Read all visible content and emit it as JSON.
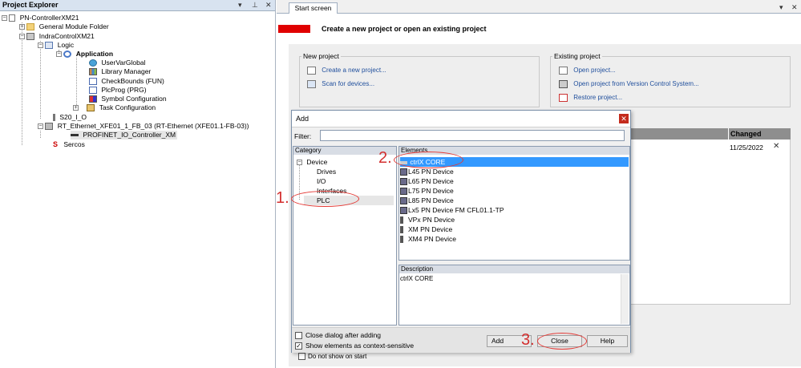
{
  "project_explorer": {
    "title": "Project Explorer",
    "pin_icon": "pin-icon",
    "close_icon": "close-icon",
    "tree": [
      {
        "label": "PN-ControllerXM21",
        "indent": 0,
        "expander": "-",
        "icon": "project-icon"
      },
      {
        "label": "General Module Folder",
        "indent": 1,
        "expander": "+",
        "icon": "folder-icon"
      },
      {
        "label": "IndraControlXM21",
        "indent": 1,
        "expander": "-",
        "icon": "device-icon"
      },
      {
        "label": "Logic",
        "indent": 2,
        "expander": "-",
        "icon": "logic-icon"
      },
      {
        "label": "Application",
        "indent": 3,
        "expander": "-",
        "icon": "application-icon",
        "bold": true
      },
      {
        "label": "UserVarGlobal",
        "indent": 4,
        "icon": "globe-icon"
      },
      {
        "label": "Library Manager",
        "indent": 4,
        "icon": "library-icon"
      },
      {
        "label": "CheckBounds (FUN)",
        "indent": 4,
        "icon": "function-icon"
      },
      {
        "label": "PlcProg (PRG)",
        "indent": 4,
        "icon": "program-icon"
      },
      {
        "label": "Symbol Configuration",
        "indent": 4,
        "icon": "symbol-icon"
      },
      {
        "label": "Task Configuration",
        "indent": 4,
        "expander": "+",
        "icon": "task-icon"
      },
      {
        "label": "S20_I_O",
        "indent": 2,
        "icon": "io-icon"
      },
      {
        "label": "RT_Ethernet_XFE01_1_FB_03 (RT-Ethernet (XFE01.1-FB-03))",
        "indent": 1,
        "expander": "-",
        "icon": "ethernet-icon"
      },
      {
        "label": "PROFINET_IO_Controller_XM",
        "indent": 2,
        "icon": "profinet-icon",
        "selected": true
      },
      {
        "label": "Sercos",
        "indent": 1,
        "icon": "sercos-icon"
      }
    ]
  },
  "start_screen": {
    "tab_label": "Start screen",
    "heading": "Create a new project or open an existing project",
    "accent_color": "#e00000",
    "new_project": {
      "title": "New project",
      "links": [
        {
          "label": "Create a new project...",
          "icon": "new-project-icon"
        },
        {
          "label": "Scan for devices...",
          "icon": "scan-icon"
        }
      ]
    },
    "existing_project": {
      "title": "Existing project",
      "links": [
        {
          "label": "Open project...",
          "icon": "open-project-icon"
        },
        {
          "label": "Open project from Version Control System...",
          "icon": "vcs-icon"
        },
        {
          "label": "Restore project...",
          "icon": "restore-icon"
        }
      ]
    },
    "recent": {
      "changed_header": "Changed",
      "changed_value": "11/25/2022",
      "remove_icon": "remove-icon"
    },
    "do_not_show": "Do not show on start"
  },
  "add_dialog": {
    "title": "Add",
    "filter_label": "Filter:",
    "filter_value": "",
    "category_header": "Category",
    "categories": [
      {
        "label": "Device",
        "expander": "-"
      },
      {
        "label": "Drives"
      },
      {
        "label": "I/O"
      },
      {
        "label": "Interfaces"
      },
      {
        "label": "PLC",
        "selected": true
      }
    ],
    "elements_header": "Elements",
    "elements": [
      {
        "label": "ctrlX CORE",
        "selected": true
      },
      {
        "label": "L45 PN Device"
      },
      {
        "label": "L65 PN Device"
      },
      {
        "label": "L75 PN Device"
      },
      {
        "label": "L85 PN Device"
      },
      {
        "label": "Lx5 PN Device FM CFL01.1-TP"
      },
      {
        "label": "VPx PN Device"
      },
      {
        "label": "XM PN Device"
      },
      {
        "label": "XM4 PN Device"
      }
    ],
    "description_header": "Description",
    "description_text": "ctrlX CORE",
    "close_after_adding": "Close dialog after adding",
    "close_after_adding_checked": false,
    "show_context": "Show elements as context-sensitive",
    "show_context_checked": true,
    "add_label": "Add",
    "close_label": "Close",
    "help_label": "Help",
    "selection_color": "#3399ff"
  },
  "annotations": {
    "step1": "1.",
    "step2": "2.",
    "step3": "3.",
    "color": "#e53935"
  }
}
